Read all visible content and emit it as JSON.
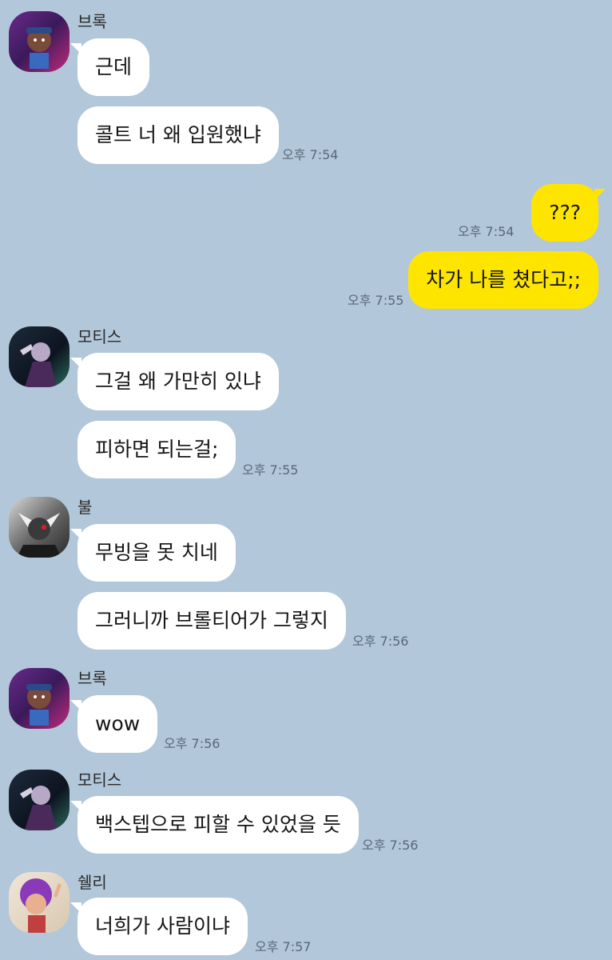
{
  "colors": {
    "background": "#b2c7da",
    "incoming_bubble": "#ffffff",
    "outgoing_bubble": "#fee500",
    "time_text": "#59687a"
  },
  "messages": [
    {
      "sender": "브록",
      "avatar_icon": "brock-avatar-icon",
      "bubbles": [
        "근데",
        "콜트 너 왜 입원했냐"
      ],
      "time": "오후 7:54"
    },
    {
      "mine": true,
      "bubbles": [
        {
          "text": "???",
          "time": "오후 7:54"
        },
        {
          "text": "차가 나를 쳤다고;;",
          "time": "오후 7:55"
        }
      ]
    },
    {
      "sender": "모티스",
      "avatar_icon": "mortis-avatar-icon",
      "bubbles": [
        "그걸 왜 가만히 있냐",
        "피하면 되는걸;"
      ],
      "time": "오후 7:55"
    },
    {
      "sender": "불",
      "avatar_icon": "bull-avatar-icon",
      "bubbles": [
        "무빙을 못 치네",
        "그러니까 브롤티어가 그렇지"
      ],
      "time": "오후 7:56"
    },
    {
      "sender": "브록",
      "avatar_icon": "brock-avatar-icon",
      "bubbles": [
        "wow"
      ],
      "time": "오후 7:56"
    },
    {
      "sender": "모티스",
      "avatar_icon": "mortis-avatar-icon",
      "bubbles": [
        "백스텝으로 피할 수 있었을 듯"
      ],
      "time": "오후 7:56"
    },
    {
      "sender": "쉘리",
      "avatar_icon": "shelly-avatar-icon",
      "bubbles": [
        "너희가 사람이냐"
      ],
      "time": "오후 7:57"
    }
  ]
}
